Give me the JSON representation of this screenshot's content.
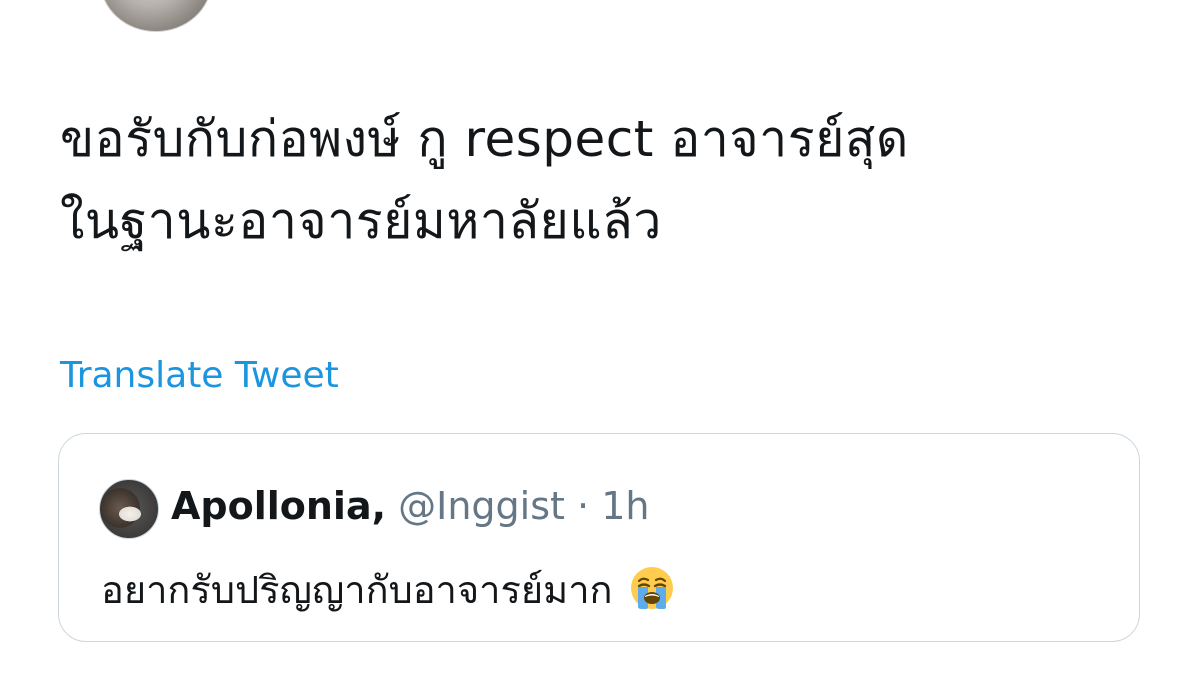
{
  "tweet": {
    "text_lines": [
      "ขอรับกับก่อพงษ์ กู respect อาจารย์สุด",
      "ในฐานะอาจารย์มหาลัยแล้ว"
    ],
    "translate_label": "Translate Tweet"
  },
  "quote": {
    "name": "Apollonia,",
    "handle": "@Inggist",
    "separator": "·",
    "time": "1h",
    "text": "อยากรับปริญญากับอาจารย์มาก",
    "emoji_icon": "loudly-crying-face-icon"
  },
  "colors": {
    "link": "#1b95e0",
    "secondary_text": "#657786",
    "border": "#ccd6dd",
    "primary_text": "#14171a"
  }
}
